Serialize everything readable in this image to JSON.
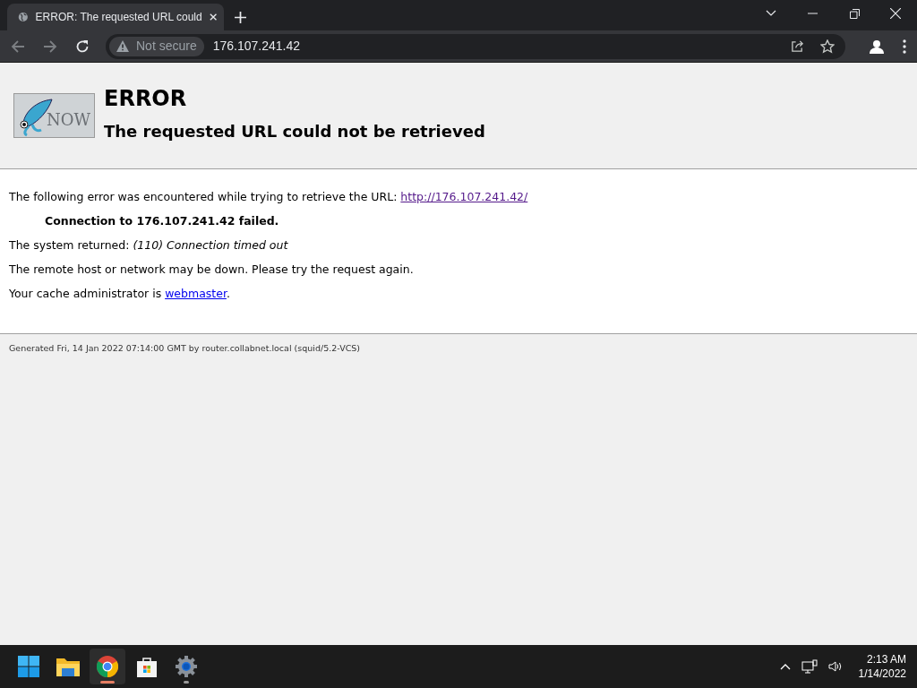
{
  "browser": {
    "tabs": [
      {
        "title": "ERROR: The requested URL could",
        "selected": true
      }
    ],
    "address_bar": {
      "security": "Not secure",
      "url": "176.107.241.42"
    }
  },
  "page": {
    "logo_text": "NOW",
    "title": "ERROR",
    "subtitle": "The requested URL could not be retrieved",
    "intro": "The following error was encountered while trying to retrieve the URL: ",
    "intro_link": "http://176.107.241.42/",
    "error_detail": "Connection to 176.107.241.42 failed.",
    "system_returned_label": "The system returned: ",
    "system_returned_value": "(110) Connection timed out",
    "advice": "The remote host or network may be down. Please try the request again.",
    "admin_prefix": "Your cache administrator is ",
    "admin_link": "webmaster",
    "admin_suffix": ".",
    "footer": "Generated Fri, 14 Jan 2022 07:14:00 GMT by router.collabnet.local (squid/5.2-VCS)"
  },
  "taskbar": {
    "apps": [
      {
        "kind": "start",
        "active": false,
        "running": false
      },
      {
        "kind": "files",
        "active": false,
        "running": false
      },
      {
        "kind": "chrome",
        "active": true,
        "running": true
      },
      {
        "kind": "store",
        "active": false,
        "running": false
      },
      {
        "kind": "settings",
        "active": false,
        "running": true
      }
    ],
    "clock": {
      "time": "2:13 AM",
      "date": "1/14/2022"
    }
  }
}
